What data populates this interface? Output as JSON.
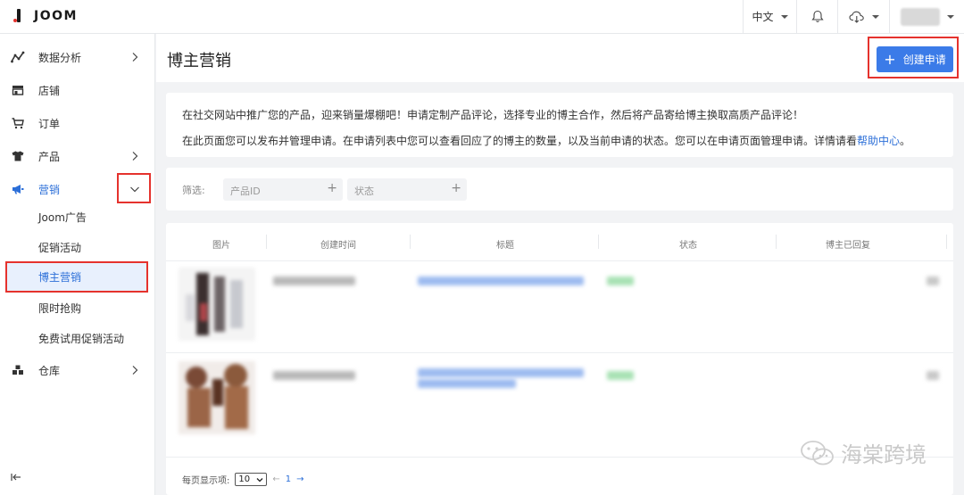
{
  "app": {
    "brand": "JOOM"
  },
  "topbar": {
    "language": "中文"
  },
  "sidebar": {
    "items": [
      {
        "label": "数据分析",
        "icon": "analytics-icon"
      },
      {
        "label": "店铺",
        "icon": "store-icon"
      },
      {
        "label": "订单",
        "icon": "cart-icon"
      },
      {
        "label": "产品",
        "icon": "shirt-icon"
      },
      {
        "label": "营销",
        "icon": "megaphone-icon"
      },
      {
        "label": "仓库",
        "icon": "warehouse-icon"
      }
    ],
    "marketing_sub": [
      {
        "label": "Joom广告"
      },
      {
        "label": "促销活动"
      },
      {
        "label": "博主营销"
      },
      {
        "label": "限时抢购"
      },
      {
        "label": "免费试用促销活动"
      }
    ]
  },
  "page": {
    "title": "博主营销",
    "create_button": "创建申请"
  },
  "info": {
    "line1": "在社交网站中推广您的产品，迎来销量爆棚吧！申请定制产品评论，选择专业的博主合作，然后将产品寄给博主换取高质产品评论！",
    "line2": "在此页面您可以发布并管理申请。在申请列表中您可以查看回应了的博主的数量，以及当前申请的状态。您可以在申请页面管理申请。详情请看",
    "help_link": "帮助中心",
    "line2_end": "。"
  },
  "filter": {
    "label": "筛选:",
    "product_id": "产品ID",
    "status": "状态"
  },
  "table": {
    "columns": [
      "图片",
      "创建时间",
      "标题",
      "状态",
      "博主已回复"
    ]
  },
  "pagination": {
    "per_page_label": "每页显示项:",
    "per_page": "10",
    "prev": "←",
    "current": "1",
    "next": "→"
  },
  "watermark": "海棠跨境",
  "colors": {
    "accent": "#3b7be8",
    "highlight": "#e5322d",
    "active_text": "#2c6fd8"
  }
}
